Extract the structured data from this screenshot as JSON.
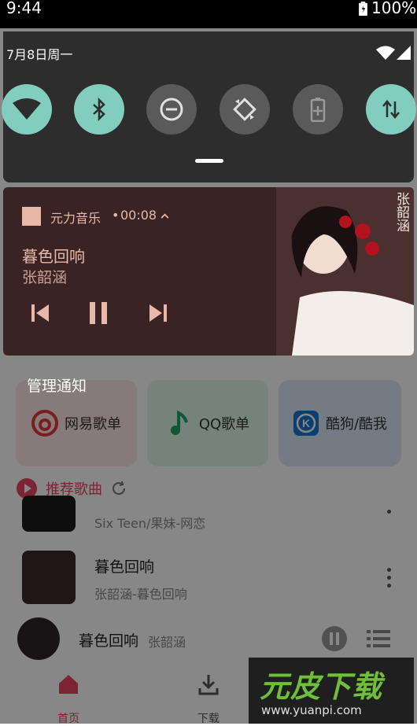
{
  "status_bar": {
    "time": "9:44",
    "battery": "100%"
  },
  "shade": {
    "date": "7月8日周一",
    "tiles": [
      {
        "name": "wifi",
        "state": "on"
      },
      {
        "name": "bluetooth",
        "state": "on"
      },
      {
        "name": "do-not-disturb",
        "state": "off"
      },
      {
        "name": "auto-rotate",
        "state": "off"
      },
      {
        "name": "battery-saver",
        "state": "off"
      },
      {
        "name": "mobile-data",
        "state": "on"
      }
    ]
  },
  "media": {
    "app_name": "元力音乐",
    "elapsed": "00:08",
    "title": "暮色回响",
    "artist": "张韶涵",
    "album_art_text": "张韶涵",
    "colors": {
      "background": "#3a2325",
      "accent": "#e8b8a8"
    }
  },
  "manage_label": "管理通知",
  "app": {
    "shortcuts": [
      {
        "label": "网易歌单",
        "icon": "netease-music-icon"
      },
      {
        "label": "QQ歌单",
        "icon": "qq-music-icon"
      },
      {
        "label": "酷狗/酷我",
        "icon": "kugou-icon"
      }
    ],
    "section_title": "推荐歌曲",
    "songs": [
      {
        "title": "",
        "subtitle": "Six Teen/果妹-网恋"
      },
      {
        "title": "暮色回响",
        "subtitle": "张韶涵-暮色回响"
      }
    ],
    "mini_player": {
      "title": "暮色回响",
      "artist": "张韶涵"
    },
    "tabs": [
      {
        "label": "首页"
      },
      {
        "label": "下载"
      }
    ],
    "accent": "#e94560"
  },
  "watermark": {
    "brand": "元皮下载",
    "url": "www.yuanpi.com"
  }
}
